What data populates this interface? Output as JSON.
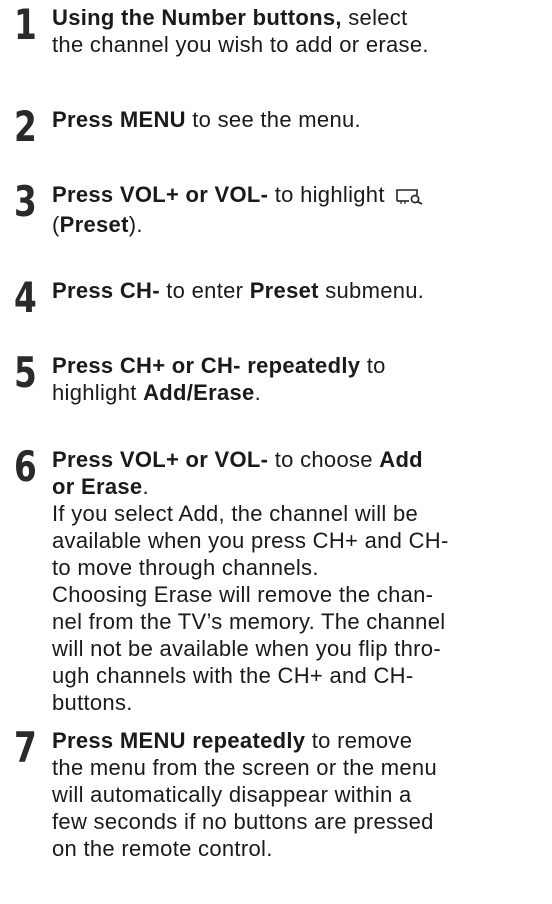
{
  "steps": [
    {
      "number": "1",
      "segments": [
        {
          "text": "Using the Number buttons,",
          "bold": true
        },
        {
          "text": " select\nthe channel you wish to add or erase.",
          "bold": false
        }
      ]
    },
    {
      "number": "2",
      "segments": [
        {
          "text": "Press MENU",
          "bold": true
        },
        {
          "text": " to see the menu.",
          "bold": false
        }
      ]
    },
    {
      "number": "3",
      "segments": [
        {
          "text": "Press VOL+ or VOL-",
          "bold": true
        },
        {
          "text": " to highlight ",
          "bold": false
        },
        {
          "icon": "preset-icon"
        },
        {
          "text": "\n(",
          "bold": false
        },
        {
          "text": "Preset",
          "bold": true
        },
        {
          "text": ").",
          "bold": false
        }
      ]
    },
    {
      "number": "4",
      "segments": [
        {
          "text": "Press CH-",
          "bold": true
        },
        {
          "text": " to enter ",
          "bold": false
        },
        {
          "text": "Preset",
          "bold": true
        },
        {
          "text": " submenu.",
          "bold": false
        }
      ]
    },
    {
      "number": "5",
      "segments": [
        {
          "text": "Press CH+ or CH- repeatedly",
          "bold": true
        },
        {
          "text": " to\nhighlight ",
          "bold": false
        },
        {
          "text": "Add/Erase",
          "bold": true
        },
        {
          "text": ".",
          "bold": false
        }
      ]
    },
    {
      "number": "6",
      "segments": [
        {
          "text": "Press VOL+ or VOL-",
          "bold": true
        },
        {
          "text": " to choose ",
          "bold": false
        },
        {
          "text": "Add\nor Erase",
          "bold": true
        },
        {
          "text": ".\nIf you select Add, the channel will be\navailable when you press CH+ and CH-\nto move through channels.\nChoosing Erase will remove the chan-\nnel from the TV’s memory. The channel\nwill not be available when you flip thro-\nugh channels with the CH+ and CH-\nbuttons.",
          "bold": false
        }
      ]
    },
    {
      "number": "7",
      "segments": [
        {
          "text": "Press MENU repeatedly",
          "bold": true
        },
        {
          "text": " to remove\nthe menu from the screen or the menu\nwill automatically disappear within a\nfew seconds if no buttons are pressed\non the remote control.",
          "bold": false
        }
      ]
    }
  ]
}
